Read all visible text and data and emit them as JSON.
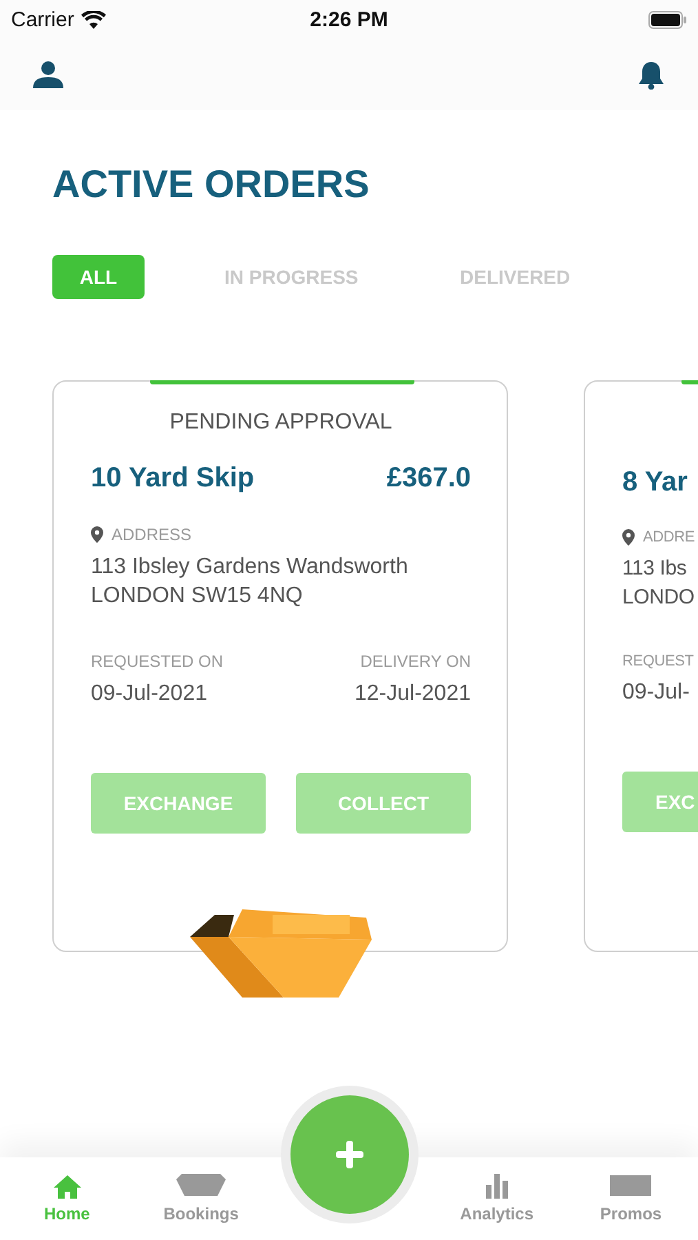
{
  "status_bar": {
    "carrier": "Carrier",
    "time": "2:26 PM"
  },
  "title": "ACTIVE ORDERS",
  "tabs": [
    {
      "label": "ALL",
      "selected": true
    },
    {
      "label": "IN PROGRESS",
      "selected": false
    },
    {
      "label": "DELIVERED",
      "selected": false
    }
  ],
  "orders": [
    {
      "status": "PENDING APPROVAL",
      "name": "10 Yard Skip",
      "price": "£367.0",
      "address_label": "ADDRESS",
      "address": [
        "113 Ibsley Gardens  Wandsworth",
        "LONDON SW15 4NQ"
      ],
      "requested_label": "REQUESTED ON",
      "requested": "09-Jul-2021",
      "delivery_label": "DELIVERY ON",
      "delivery": "12-Jul-2021",
      "buttons": [
        "EXCHANGE",
        "COLLECT"
      ]
    },
    {
      "name": "8 Yar",
      "address_label": "ADDRE",
      "address": [
        "113 Ibs",
        "LONDO"
      ],
      "requested_label": "REQUEST",
      "requested": "09-Jul-",
      "buttons": [
        "EXC"
      ]
    }
  ],
  "nav": [
    {
      "label": "Home",
      "selected": true
    },
    {
      "label": "Bookings",
      "selected": false
    },
    {
      "label": "Analytics",
      "selected": false
    },
    {
      "label": "Promos",
      "selected": false
    }
  ]
}
